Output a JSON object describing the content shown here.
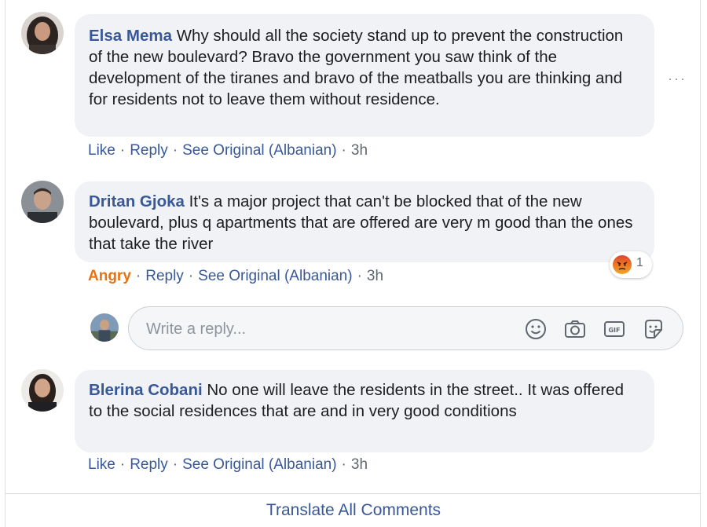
{
  "comments": [
    {
      "author": "Elsa Mema",
      "text": "Why should all the society stand up to prevent the construction of the new boulevard? Bravo the government you saw think of the development of the tiranes and bravo of the meatballs you are thinking and for residents not to leave them without residence.",
      "actions": {
        "like": "Like",
        "reply": "Reply",
        "see_original": "See Original (Albanian)",
        "time": "3h"
      }
    },
    {
      "author": "Dritan Gjoka",
      "text": "It's a major project that can't be blocked that of the new boulevard, plus q apartments that are offered are very m good than the ones that take the river",
      "actions": {
        "like": "Angry",
        "reply": "Reply",
        "see_original": "See Original (Albanian)",
        "time": "3h"
      },
      "reaction": {
        "icon": "angry-reaction-icon",
        "count": "1"
      }
    },
    {
      "author": "Blerina Cobani",
      "text": "No one will leave the residents in the street.. It was offered to the social residences that are and in very good conditions",
      "actions": {
        "like": "Like",
        "reply": "Reply",
        "see_original": "See Original (Albanian)",
        "time": "3h"
      }
    }
  ],
  "reply_box": {
    "placeholder": "Write a reply...",
    "icons": [
      "emoji-icon",
      "camera-icon",
      "gif-icon",
      "sticker-icon"
    ]
  },
  "footer": {
    "translate_all": "Translate All Comments"
  },
  "more_options": "···",
  "colors": {
    "link": "#385898",
    "angry": "#e9710f",
    "bubble": "#f0f2f5",
    "text": "#1c1e21",
    "meta": "#606770"
  }
}
